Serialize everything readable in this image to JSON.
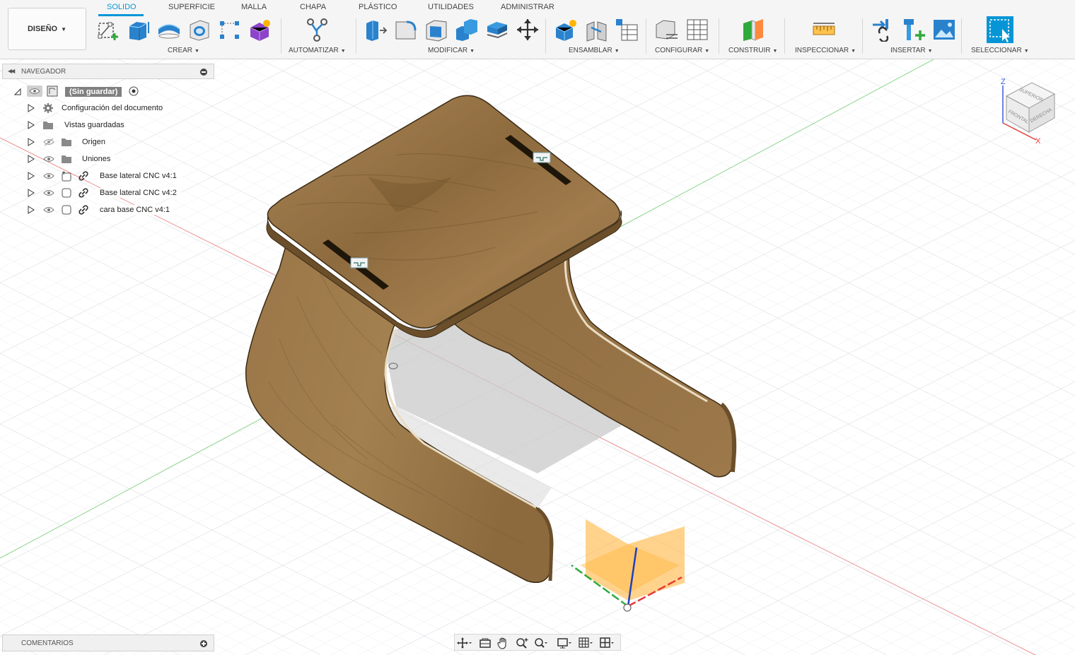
{
  "workspace": {
    "label": "DISEÑO"
  },
  "tabs": [
    {
      "id": "solido",
      "label": "SOLIDO",
      "active": true
    },
    {
      "id": "superficie",
      "label": "SUPERFICIE"
    },
    {
      "id": "malla",
      "label": "MALLA"
    },
    {
      "id": "chapa",
      "label": "CHAPA"
    },
    {
      "id": "plastico",
      "label": "PLÁSTICO"
    },
    {
      "id": "utilidades",
      "label": "UTILIDADES"
    },
    {
      "id": "administrar",
      "label": "ADMINISTRAR"
    }
  ],
  "groups": {
    "crear": "CREAR",
    "automatizar": "AUTOMATIZAR",
    "modificar": "MODIFICAR",
    "ensamblar": "ENSAMBLAR",
    "configurar": "CONFIGURAR",
    "construir": "CONSTRUIR",
    "inspeccionar": "INSPECCIONAR",
    "insertar": "INSERTAR",
    "seleccionar": "SELECCIONAR"
  },
  "colors": {
    "accent": "#0696d7",
    "wood": "#9c7a4d",
    "axis_x": "#e53935",
    "axis_y": "#43a047",
    "axis_z": "#1e3fbf"
  },
  "browser": {
    "header": "NAVEGADOR",
    "root": "(Sin guardar)",
    "items": [
      {
        "label": "Configuración del documento",
        "icon": "gear-icon"
      },
      {
        "label": "Vistas guardadas",
        "icon": "folder-icon"
      },
      {
        "label": "Origen",
        "icon": "folder-icon",
        "hidden": true
      },
      {
        "label": "Uniones",
        "icon": "folder-icon"
      },
      {
        "label": "Base lateral CNC v4:1",
        "icon": "component-icon"
      },
      {
        "label": "Base lateral CNC v4:2",
        "icon": "component-icon"
      },
      {
        "label": "cara base CNC v4:1",
        "icon": "component-icon"
      }
    ]
  },
  "viewcube": {
    "top": "SUPERIOR",
    "front": "FRONTAL",
    "right": "DERECHA",
    "axis_x": "X",
    "axis_z": "Z"
  },
  "comments": {
    "label": "COMENTARIOS"
  }
}
